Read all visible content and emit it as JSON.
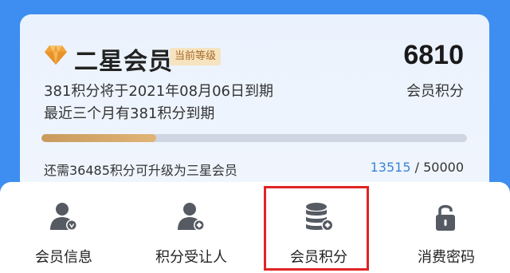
{
  "membership": {
    "level_name": "二星会员",
    "level_badge": "当前等级",
    "points": "6810",
    "points_label": "会员积分",
    "expire_line1": "381积分将于2021年08月06日到期",
    "expire_line2": "最近三个月有381积分到期",
    "upgrade_text": "还需36485积分可升级为三星会员",
    "progress_current": "13515",
    "progress_sep": " / ",
    "progress_total": "50000",
    "progress_fraction": 0.27
  },
  "menu": {
    "items": [
      {
        "label": "会员信息",
        "icon": "member-info-icon"
      },
      {
        "label": "积分受让人",
        "icon": "points-transferee-icon"
      },
      {
        "label": "会员积分",
        "icon": "member-points-icon"
      },
      {
        "label": "消费密码",
        "icon": "lock-icon"
      }
    ]
  },
  "colors": {
    "background": "#3d8ef0",
    "accent_gold": "#d9a664",
    "link_blue": "#3a84d6",
    "highlight_red": "#e02424"
  }
}
